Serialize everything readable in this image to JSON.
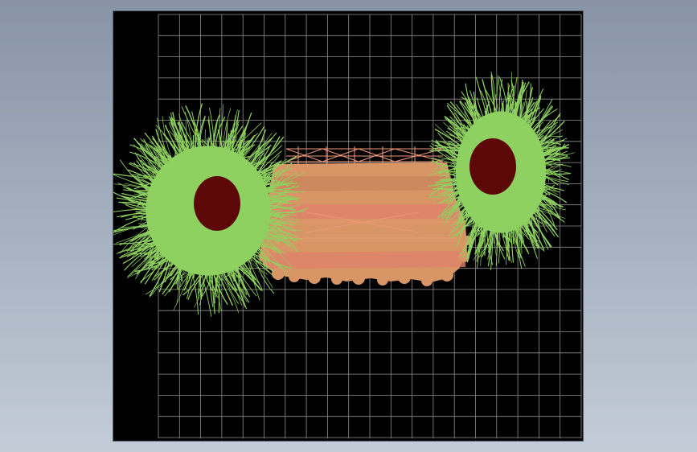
{
  "window": {
    "title": "",
    "background": "#98a4b5"
  },
  "viewport": {
    "background": "#000000",
    "grid_color": "#8f8f8f",
    "grid_on": true
  },
  "drawing": {
    "objects": [
      {
        "name": "left-plant-planter",
        "type": "plant",
        "foliage_color": "#8fd160",
        "pot_color": "#5c0808"
      },
      {
        "name": "bench",
        "type": "bench",
        "color": "#d89565",
        "accent_color": "#e0826a",
        "frame_color": "#f09a7a"
      },
      {
        "name": "right-plant-planter",
        "type": "plant",
        "foliage_color": "#8fd160",
        "pot_color": "#5c0808"
      }
    ]
  }
}
